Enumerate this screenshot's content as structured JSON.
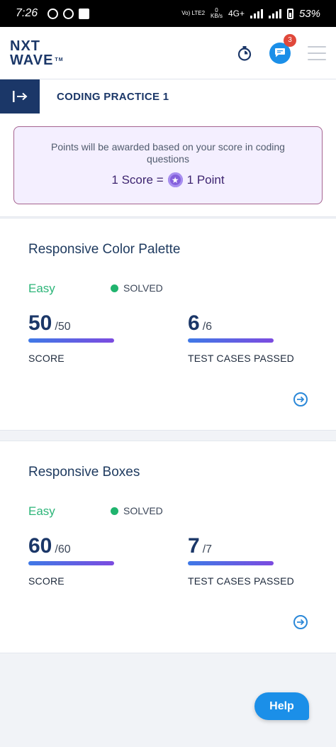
{
  "status_bar": {
    "time": "7:26",
    "network_label": "Vo) LTE2",
    "speed_value": "0",
    "speed_unit": "KB/s",
    "network_type": "4G+",
    "battery": "53%"
  },
  "header": {
    "logo_line1": "NXT",
    "logo_line2": "WAVE",
    "logo_tm": "TM",
    "chat_badge_count": "3"
  },
  "subheader": {
    "title": "CODING PRACTICE 1"
  },
  "points_info": {
    "note": "Points will be awarded based on your score in coding questions",
    "rate_left": "1 Score =",
    "rate_right": "1 Point"
  },
  "questions": [
    {
      "title": "Responsive Color Palette",
      "difficulty": "Easy",
      "status": "SOLVED",
      "score": "50",
      "score_total": "/50",
      "score_label": "SCORE",
      "tests_passed": "6",
      "tests_total": "/6",
      "tests_label": "TEST CASES PASSED"
    },
    {
      "title": "Responsive Boxes",
      "difficulty": "Easy",
      "status": "SOLVED",
      "score": "60",
      "score_total": "/60",
      "score_label": "SCORE",
      "tests_passed": "7",
      "tests_total": "/7",
      "tests_label": "TEST CASES PASSED"
    }
  ],
  "help_button": {
    "label": "Help"
  },
  "colors": {
    "brand": "#1b3768",
    "accent": "#1b8fe8",
    "easy": "#2db579",
    "solved_dot": "#20b46e"
  }
}
